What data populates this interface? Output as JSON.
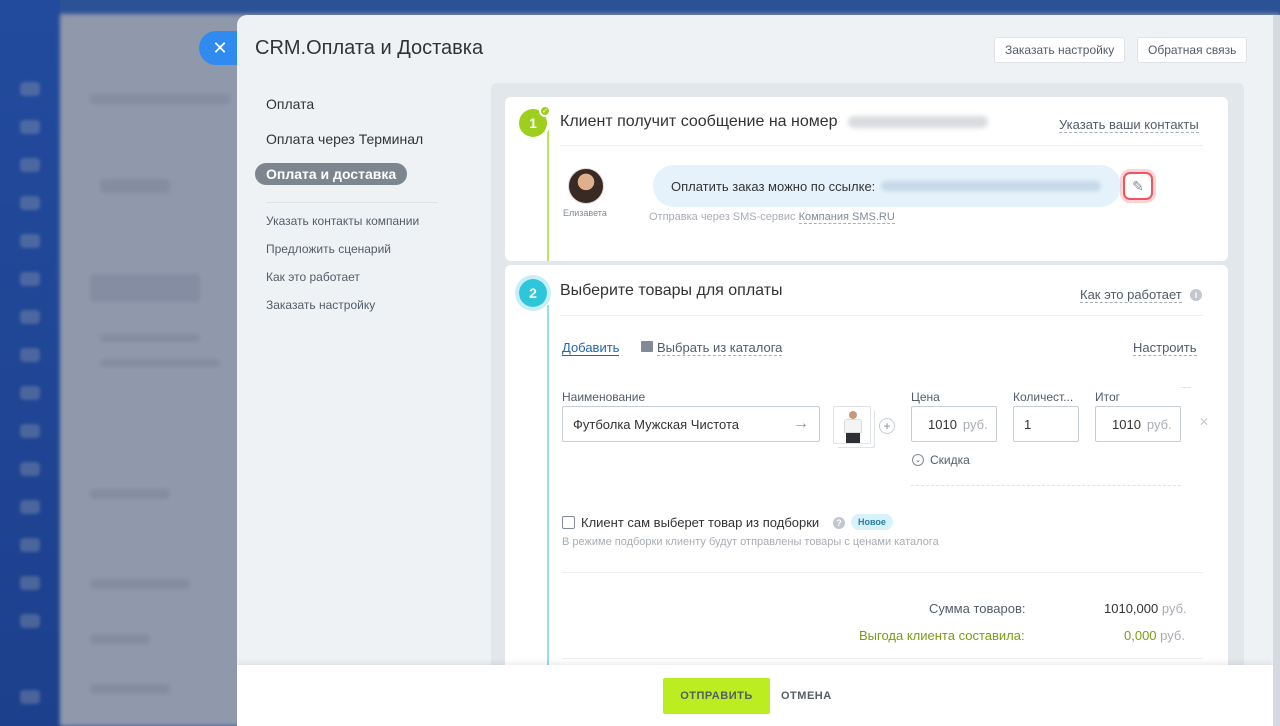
{
  "panel": {
    "title": "CRM.Оплата и Доставка",
    "order_settings": "Заказать настройку",
    "feedback": "Обратная связь"
  },
  "nav": {
    "items": [
      {
        "label": "Оплата"
      },
      {
        "label": "Оплата через Терминал"
      },
      {
        "label": "Оплата и доставка"
      }
    ],
    "subitems": [
      {
        "label": "Указать контакты компании"
      },
      {
        "label": "Предложить сценарий"
      },
      {
        "label": "Как это работает"
      },
      {
        "label": "Заказать настройку"
      }
    ]
  },
  "step1": {
    "number": "1",
    "title": "Клиент получит сообщение на номер",
    "contacts_link": "Указать ваши контакты",
    "avatar_name": "Елизавета",
    "message": "Оплатить заказ можно по ссылке:",
    "sms_note_prefix": "Отправка через SMS-сервис",
    "sms_provider": "Компания SMS.RU"
  },
  "step2": {
    "number": "2",
    "title": "Выберите товары для оплаты",
    "how_link": "Как это работает",
    "add_link": "Добавить",
    "catalog_link": "Выбрать из каталога",
    "configure_link": "Настроить",
    "labels": {
      "name": "Наименование",
      "price": "Цена",
      "quantity": "Количест...",
      "total": "Итог"
    },
    "product": {
      "name": "Футболка Мужская Чистота",
      "price": "1010",
      "price_unit": "руб.",
      "quantity": "1",
      "total": "1010",
      "total_unit": "руб.",
      "discount": "Скидка"
    },
    "selection_label": "Клиент сам выберет товар из подборки",
    "new_badge": "Новое",
    "selection_hint": "В режиме подборки клиенту будут отправлены товары с ценами каталога",
    "sum_label": "Сумма товаров:",
    "sum_value": "1010,000",
    "sum_unit": "руб.",
    "benefit_label": "Выгода клиента составила:",
    "benefit_value": "0,000",
    "benefit_unit": "руб."
  },
  "footer": {
    "send": "ОТПРАВИТЬ",
    "cancel": "ОТМЕНА"
  },
  "colors": {
    "accent_blue": "#2f8bf0",
    "step1_green": "#9ecf1f",
    "step2_cyan": "#2fc6dc",
    "send_button": "#bbed21",
    "benefit_green": "#7d9a15",
    "edit_highlight": "#f2545b"
  },
  "icons": {
    "close": "close-icon",
    "edit": "pencil-icon",
    "catalog": "book-icon",
    "arrow": "arrow-right-icon",
    "check": "check-icon"
  }
}
